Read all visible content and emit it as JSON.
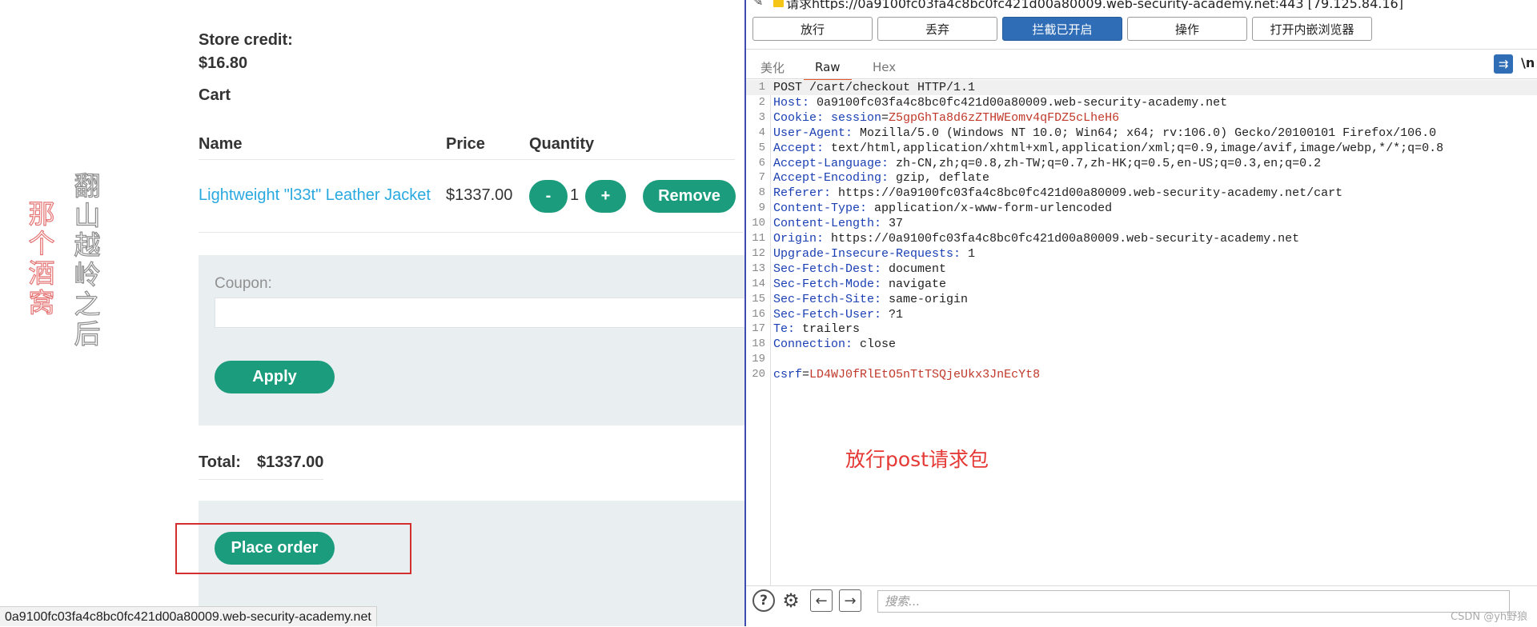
{
  "watermark": {
    "left_text": "那个酒窝",
    "right_text": "翻山越岭之后"
  },
  "shop": {
    "store_credit_label": "Store credit:",
    "store_credit_value": "$16.80",
    "cart_heading": "Cart",
    "columns": {
      "name": "Name",
      "price": "Price",
      "quantity": "Quantity"
    },
    "item": {
      "name": "Lightweight \"l33t\" Leather Jacket",
      "price": "$1337.00",
      "qty": "1",
      "minus": "-",
      "plus": "+",
      "remove": "Remove"
    },
    "coupon_label": "Coupon:",
    "coupon_value": "",
    "apply": "Apply",
    "total_label": "Total:",
    "total_value": "$1337.00",
    "place_order": "Place order"
  },
  "status_url": "0a9100fc03fa4c8bc0fc421d00a80009.web-security-academy.net",
  "burp": {
    "title": "请求https://0a9100fc03fa4c8bc0fc421d00a80009.web-security-academy.net:443 [79.125.84.16]",
    "toolbar": {
      "forward": "放行",
      "drop": "丢弃",
      "intercept": "拦截已开启",
      "action": "操作",
      "open_browser": "打开内嵌浏览器"
    },
    "tabs": [
      "美化",
      "Raw",
      "Hex"
    ],
    "newline_icon_text": "\\n",
    "lines": [
      {
        "n": "1",
        "text": "POST /cart/checkout HTTP/1.1"
      },
      {
        "n": "2",
        "key": "Host:",
        "val": " 0a9100fc03fa4c8bc0fc421d00a80009.web-security-academy.net"
      },
      {
        "n": "3",
        "key": "Cookie:",
        "ckey": " session",
        "eq": "=",
        "cval": "Z5gpGhTa8d6zZTHWEomv4qFDZ5cLheH6"
      },
      {
        "n": "4",
        "key": "User-Agent:",
        "val": " Mozilla/5.0 (Windows NT 10.0; Win64; x64; rv:106.0) Gecko/20100101 Firefox/106.0"
      },
      {
        "n": "5",
        "key": "Accept:",
        "val": " text/html,application/xhtml+xml,application/xml;q=0.9,image/avif,image/webp,*/*;q=0.8"
      },
      {
        "n": "6",
        "key": "Accept-Language:",
        "val": " zh-CN,zh;q=0.8,zh-TW;q=0.7,zh-HK;q=0.5,en-US;q=0.3,en;q=0.2"
      },
      {
        "n": "7",
        "key": "Accept-Encoding:",
        "val": " gzip, deflate"
      },
      {
        "n": "8",
        "key": "Referer:",
        "val": " https://0a9100fc03fa4c8bc0fc421d00a80009.web-security-academy.net/cart"
      },
      {
        "n": "9",
        "key": "Content-Type:",
        "val": " application/x-www-form-urlencoded"
      },
      {
        "n": "10",
        "key": "Content-Length:",
        "val": " 37"
      },
      {
        "n": "11",
        "key": "Origin:",
        "val": " https://0a9100fc03fa4c8bc0fc421d00a80009.web-security-academy.net"
      },
      {
        "n": "12",
        "key": "Upgrade-Insecure-Requests:",
        "val": " 1"
      },
      {
        "n": "13",
        "key": "Sec-Fetch-Dest:",
        "val": " document"
      },
      {
        "n": "14",
        "key": "Sec-Fetch-Mode:",
        "val": " navigate"
      },
      {
        "n": "15",
        "key": "Sec-Fetch-Site:",
        "val": " same-origin"
      },
      {
        "n": "16",
        "key": "Sec-Fetch-User:",
        "val": " ?1"
      },
      {
        "n": "17",
        "key": "Te:",
        "val": " trailers"
      },
      {
        "n": "18",
        "key": "Connection:",
        "val": " close"
      },
      {
        "n": "19",
        "text": ""
      },
      {
        "n": "20",
        "pkey": "csrf",
        "eq": "=",
        "pval": "LD4WJ0fRlEtO5nTtTSQjeUkx3JnEcYt8"
      }
    ],
    "annotation": "放行post请求包",
    "search_placeholder": "搜索...",
    "csdn": "CSDN @yh野狼"
  },
  "colors": {
    "accent_green": "#1b9c7d",
    "link_blue": "#29a9df",
    "burp_blue": "#2f6db7",
    "annotation_red": "#e53935"
  }
}
